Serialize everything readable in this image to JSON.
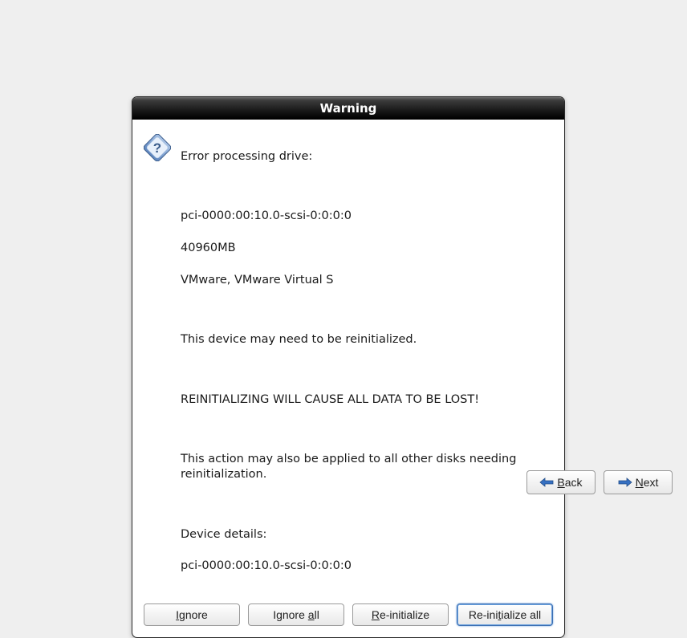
{
  "dialog": {
    "title": "Warning",
    "message": {
      "headline": "Error processing drive:",
      "device_path": "pci-0000:00:10.0-scsi-0:0:0:0",
      "size": "40960MB",
      "vendor": "VMware, VMware Virtual S",
      "reinit_notice": "This device may need to be reinitialized.",
      "data_loss": "REINITIALIZING WILL CAUSE ALL DATA TO BE LOST!",
      "apply_all": "This action may also be applied to all other disks needing reinitialization.",
      "details_label": "Device details:",
      "details_value": "pci-0000:00:10.0-scsi-0:0:0:0"
    },
    "buttons": {
      "ignore": "Ignore",
      "ignore_all_pre": "Ignore ",
      "ignore_all_m": "a",
      "ignore_all_post": "ll",
      "reinit_m": "R",
      "reinit_post": "e-initialize",
      "reinit_all_pre": "Re-ini",
      "reinit_all_m": "t",
      "reinit_all_post": "ialize all"
    }
  },
  "footer": {
    "back_m": "B",
    "back_post": "ack",
    "next_m": "N",
    "next_post": "ext"
  }
}
